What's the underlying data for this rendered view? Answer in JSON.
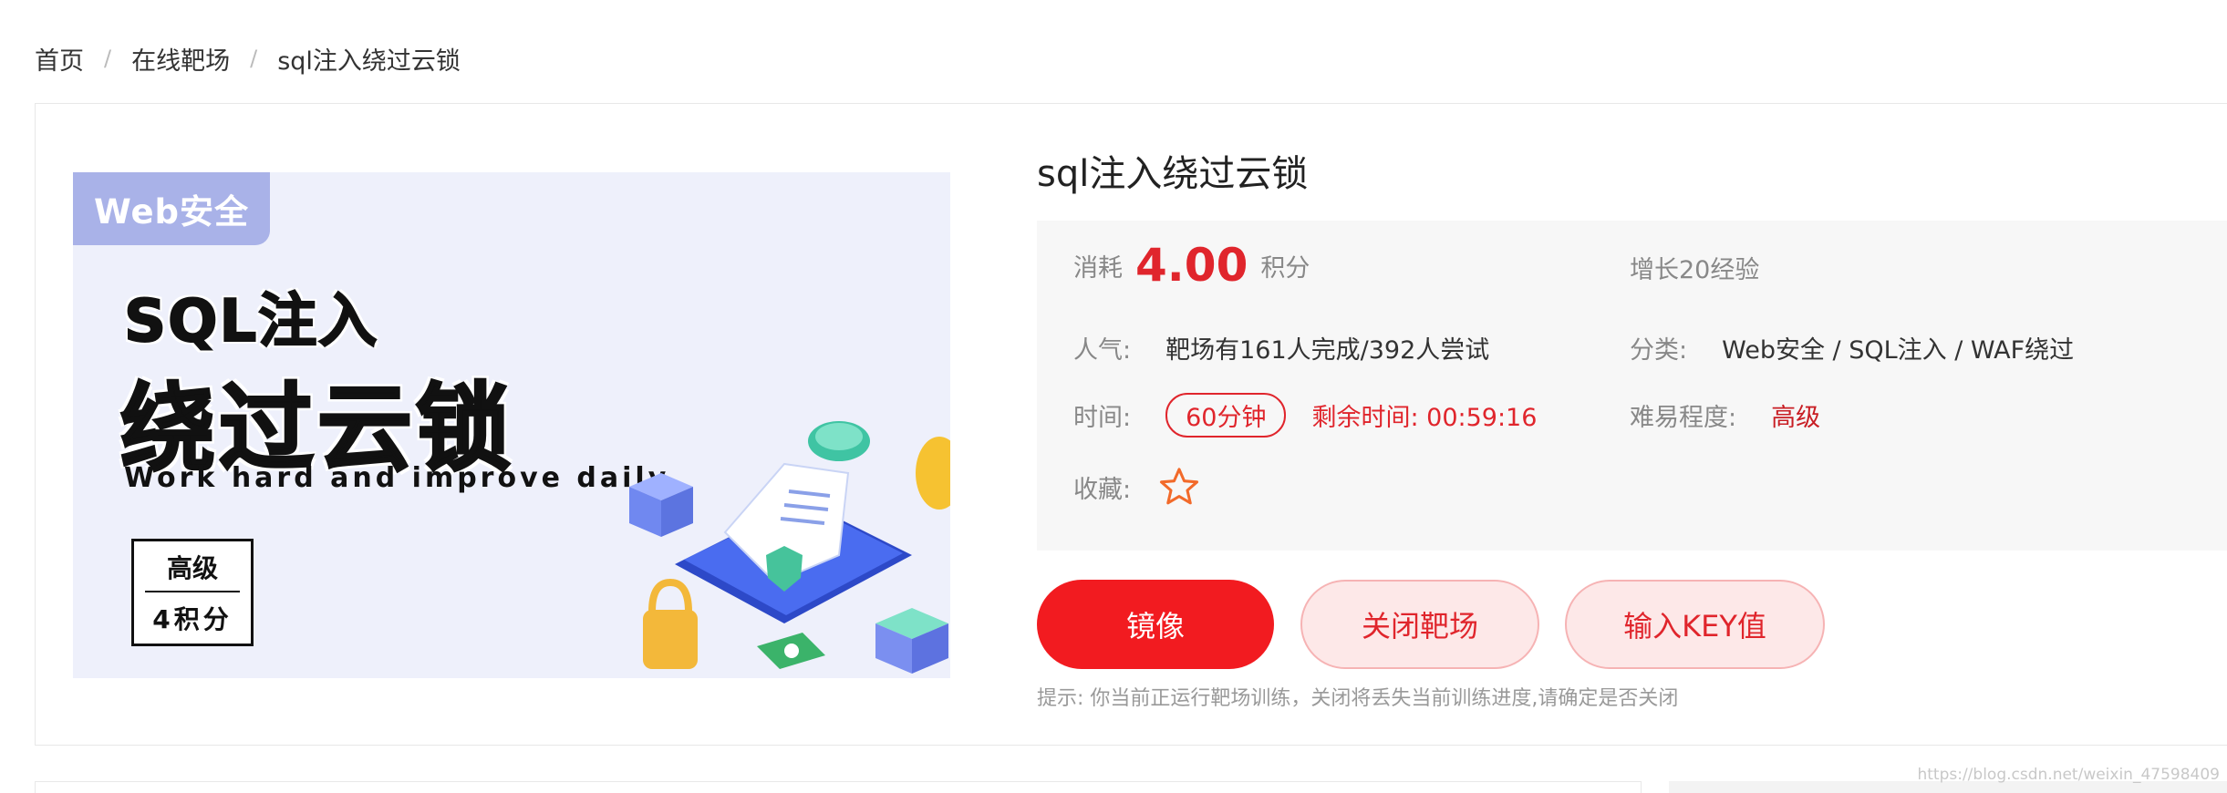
{
  "breadcrumb": {
    "items": [
      "首页",
      "在线靶场",
      "sql注入绕过云锁"
    ],
    "separator": "/"
  },
  "cover": {
    "tag": "Web安全",
    "heading_line1": "SQL注入",
    "heading_line2": "绕过云锁",
    "slogan": "Work hard and improve daily",
    "level": "高级",
    "points": "4积分"
  },
  "detail": {
    "title": "sql注入绕过云锁",
    "cost_label": "消耗",
    "cost_value": "4.00",
    "cost_unit": "积分",
    "exp": "增长20经验",
    "popularity_label": "人气:",
    "popularity_value": "靶场有161人完成/392人尝试",
    "category_label": "分类:",
    "category_value": "Web安全 / SQL注入 / WAF绕过",
    "time_label": "时间:",
    "duration": "60分钟",
    "remaining": "剩余时间: 00:59:16",
    "difficulty_label": "难易程度:",
    "difficulty_value": "高级",
    "favorite_label": "收藏:"
  },
  "buttons": {
    "mirror": "镜像",
    "close_range": "关闭靶场",
    "enter_key": "输入KEY值"
  },
  "tip": "提示: 你当前正运行靶场训练，关闭将丢失当前训练进度,请确定是否关闭",
  "watermark": "https://blog.csdn.net/weixin_47598409",
  "colors": {
    "accent": "#e0252c",
    "primary_button": "#f21b20",
    "tag_bg": "#a9b2e8",
    "cover_bg": "#eef0fb"
  }
}
